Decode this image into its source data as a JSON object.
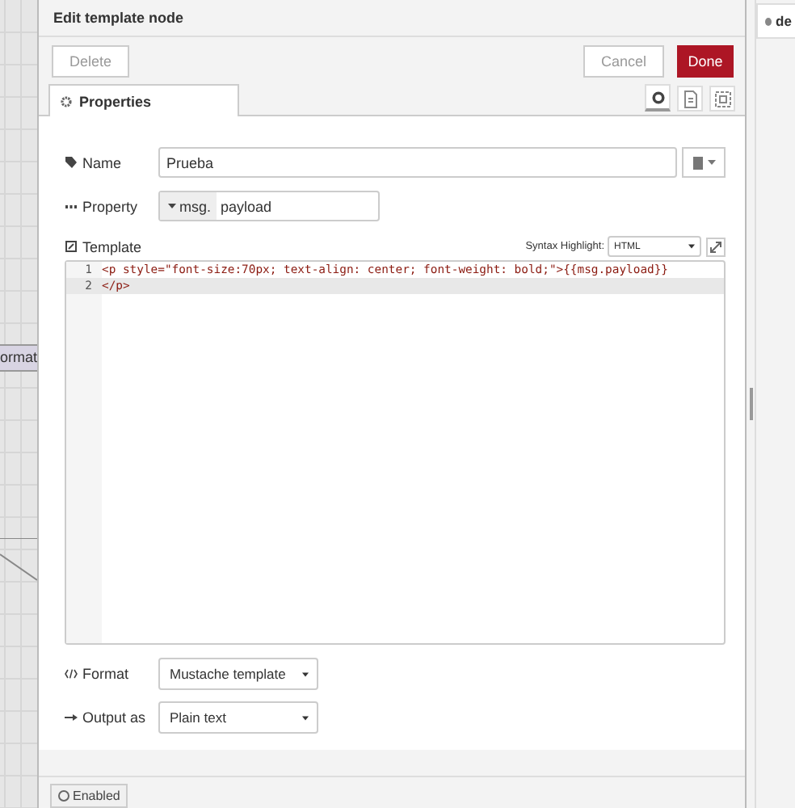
{
  "canvas": {
    "node_label": "ormat"
  },
  "dialog": {
    "title": "Edit template node",
    "buttons": {
      "delete": "Delete",
      "cancel": "Cancel",
      "done": "Done"
    },
    "tabs": [
      {
        "label": "Properties",
        "selected": true
      }
    ],
    "name": {
      "label": "Name",
      "value": "Prueba"
    },
    "property": {
      "label": "Property",
      "prefix": "msg.",
      "value": "payload"
    },
    "template": {
      "label": "Template",
      "syntax_label": "Syntax Highlight:",
      "syntax_value": "HTML",
      "lines": [
        {
          "number": "1",
          "text": "<p style=\"font-size:70px; text-align: center; font-weight: bold;\">{{msg.payload}}",
          "active": false
        },
        {
          "number": "2",
          "text": "</p>",
          "active": true
        }
      ]
    },
    "format": {
      "label": "Format",
      "value": "Mustache template"
    },
    "output": {
      "label": "Output as",
      "value": "Plain text"
    },
    "footer": {
      "enabled_label": "Enabled"
    }
  },
  "sidebar": {
    "tab_label": "de"
  }
}
